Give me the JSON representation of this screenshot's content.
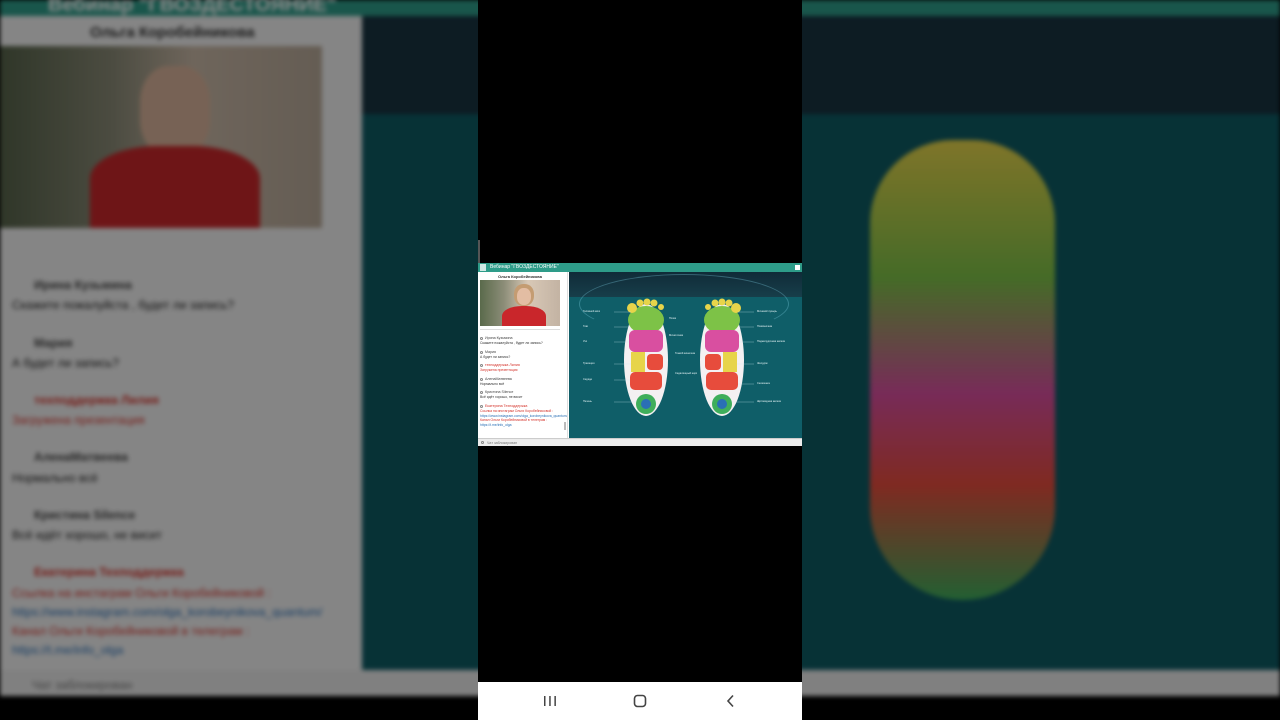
{
  "window": {
    "title": "Вебинар \"ГВОЗДЕСТОЯНИЕ\""
  },
  "speaker": {
    "name": "Ольга Коробейникова"
  },
  "chat": {
    "messages": [
      {
        "author": "Ирина Кузьмина",
        "text": "Скажите пожалуйста , будет ли запись?",
        "staff": false,
        "style": "normal"
      },
      {
        "author": "Мария",
        "text": "А будет ли запись?",
        "staff": false,
        "style": "normal"
      },
      {
        "author": "техподдержка Лилия",
        "text": "Загружена презентация",
        "staff": true,
        "style": "red"
      },
      {
        "author": "АленаМатвеева",
        "text": "Нормально всё",
        "staff": false,
        "style": "normal"
      },
      {
        "author": "Кристина Silence",
        "text": "Всё идёт хорошо, не висит",
        "staff": false,
        "style": "normal"
      },
      {
        "author": "Екатерина Техподдержка",
        "text": "Ссылка на инстаграм Ольги Коробейниковой :",
        "text2": "https://www.instagram.com/olga_korobeynikova_quantum/",
        "text3": "Канал Ольги Коробейниковой в телеграм :",
        "text4": "https://t.me/info_olga",
        "staff": true,
        "style": "red"
      }
    ],
    "footer_status": "Чат заблокирован"
  },
  "slide": {
    "labels": [
      "Головной мозг",
      "Глаз",
      "Ухо",
      "Трапеция",
      "Сердце",
      "Печень",
      "Почки",
      "Мочеточник",
      "Мочевой пузырь",
      "Позвоночник",
      "Поджелудочная железа",
      "Желудок",
      "Селезенка",
      "Щитовидная железа",
      "Тонкий кишечник",
      "Седалищный нерв"
    ]
  },
  "navbar": {
    "recent_icon": "recent-apps-icon",
    "home_icon": "home-icon",
    "back_icon": "back-icon"
  },
  "colors": {
    "accent": "#2e9c89",
    "staff_red": "#d4322a",
    "link_blue": "#2a6fb5",
    "slide_bg": "#0f5e68"
  }
}
